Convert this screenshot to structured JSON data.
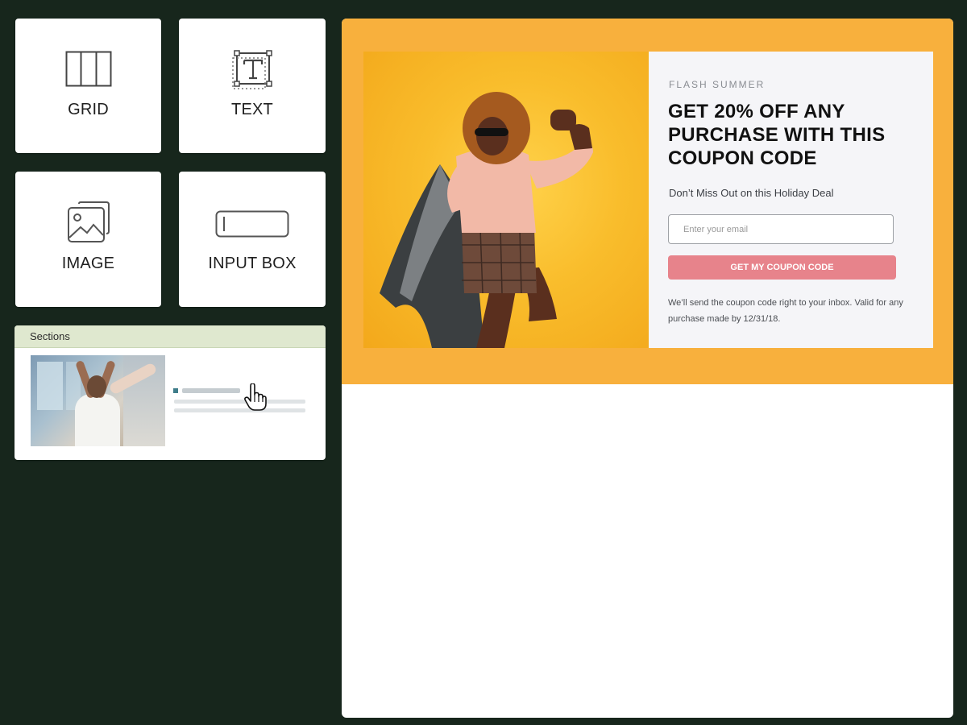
{
  "palette": {
    "elements": [
      {
        "label": "GRID",
        "icon": "grid-icon"
      },
      {
        "label": "TEXT",
        "icon": "text-icon"
      },
      {
        "label": "IMAGE",
        "icon": "image-icon"
      },
      {
        "label": "INPUT BOX",
        "icon": "input-box-icon"
      }
    ],
    "sections": {
      "title": "Sections"
    }
  },
  "canvas": {
    "banner_color": "#f8b03d",
    "offer": {
      "eyebrow": "FLASH SUMMER",
      "headline": "GET 20% OFF ANY PURCHASE WITH THIS COUPON CODE",
      "subtitle": "Don’t Miss Out on this Holiday Deal",
      "email_placeholder": "Enter your email",
      "button_label": "GET MY COUPON CODE",
      "button_color": "#e7838b",
      "note": "We’ll send the coupon code right to your inbox. Valid for any purchase made by 12/31/18."
    }
  }
}
